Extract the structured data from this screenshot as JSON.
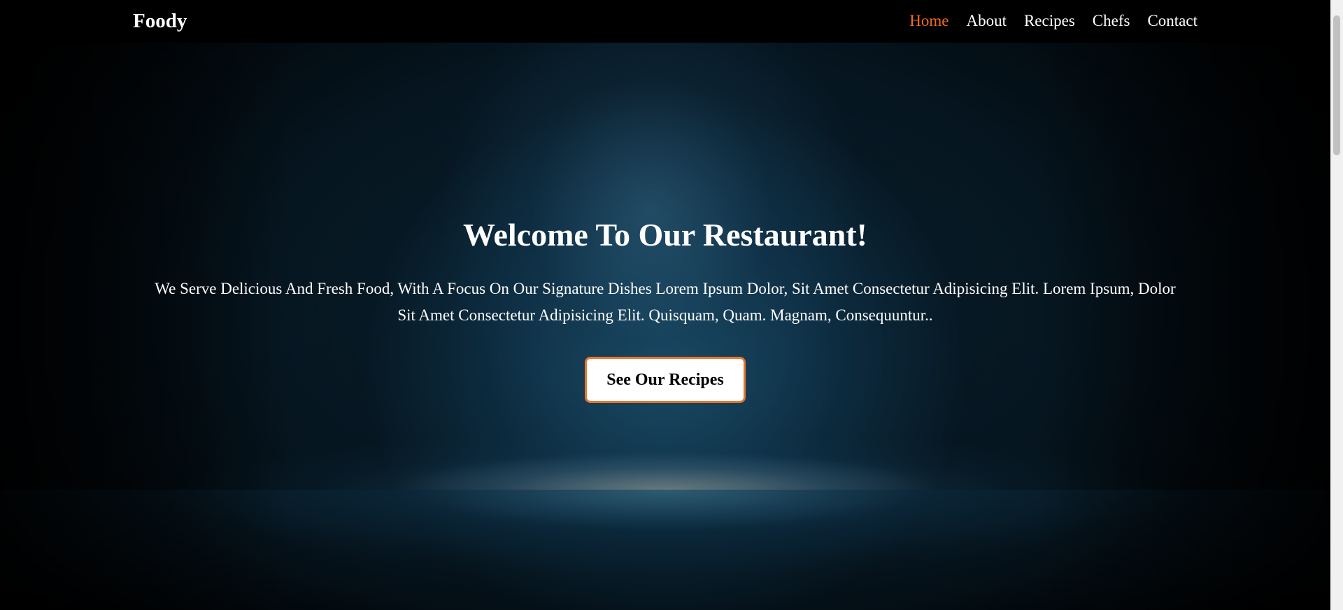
{
  "navbar": {
    "brand": "Foody",
    "links": [
      {
        "label": "Home",
        "active": true
      },
      {
        "label": "About",
        "active": false
      },
      {
        "label": "Recipes",
        "active": false
      },
      {
        "label": "Chefs",
        "active": false
      },
      {
        "label": "Contact",
        "active": false
      }
    ]
  },
  "hero": {
    "title": "Welcome To Our Restaurant!",
    "text": "We Serve Delicious And Fresh Food, With A Focus On Our Signature Dishes Lorem Ipsum Dolor, Sit Amet Consectetur Adipisicing Elit. Lorem Ipsum, Dolor Sit Amet Consectetur Adipisicing Elit. Quisquam, Quam. Magnam, Consequuntur..",
    "button_label": "See Our Recipes"
  },
  "colors": {
    "accent": "#f26a1b",
    "navbar_bg": "#000000",
    "button_border": "#e8762b"
  }
}
